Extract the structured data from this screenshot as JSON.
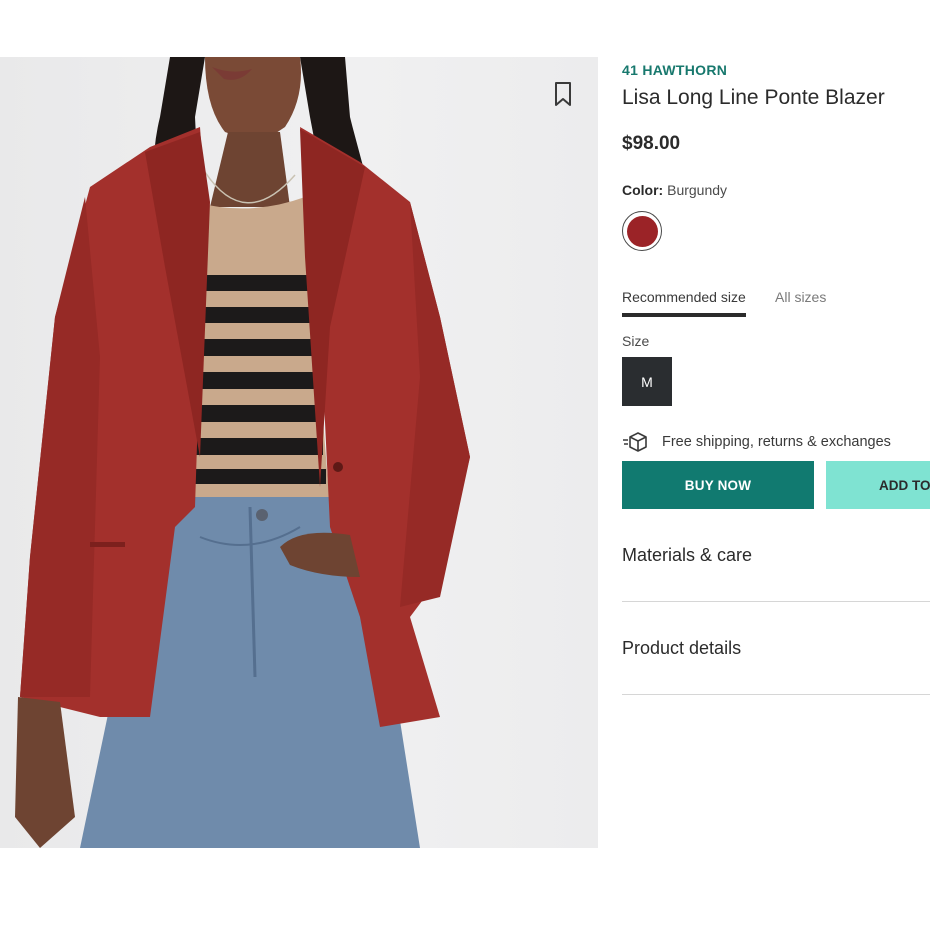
{
  "product": {
    "brand": "41 HAWTHORN",
    "title": "Lisa Long Line Ponte Blazer",
    "price": "$98.00"
  },
  "color": {
    "label": "Color:",
    "value": "Burgundy",
    "swatch_hex": "#9b2327"
  },
  "size_tabs": [
    {
      "label": "Recommended size",
      "active": true
    },
    {
      "label": "All sizes",
      "active": false
    }
  ],
  "size": {
    "label": "Size",
    "selected": "M"
  },
  "shipping": {
    "icon": "box-icon",
    "text": "Free shipping, returns & exchanges"
  },
  "actions": {
    "buy_now": "BUY NOW",
    "add_to": "ADD TO"
  },
  "sections": [
    {
      "label": "Materials & care"
    },
    {
      "label": "Product details"
    }
  ],
  "theme": {
    "brand_color": "#17786d",
    "buy_button": "#117a70",
    "add_button": "#7fe3d2",
    "size_selected_bg": "#2a2d30"
  }
}
